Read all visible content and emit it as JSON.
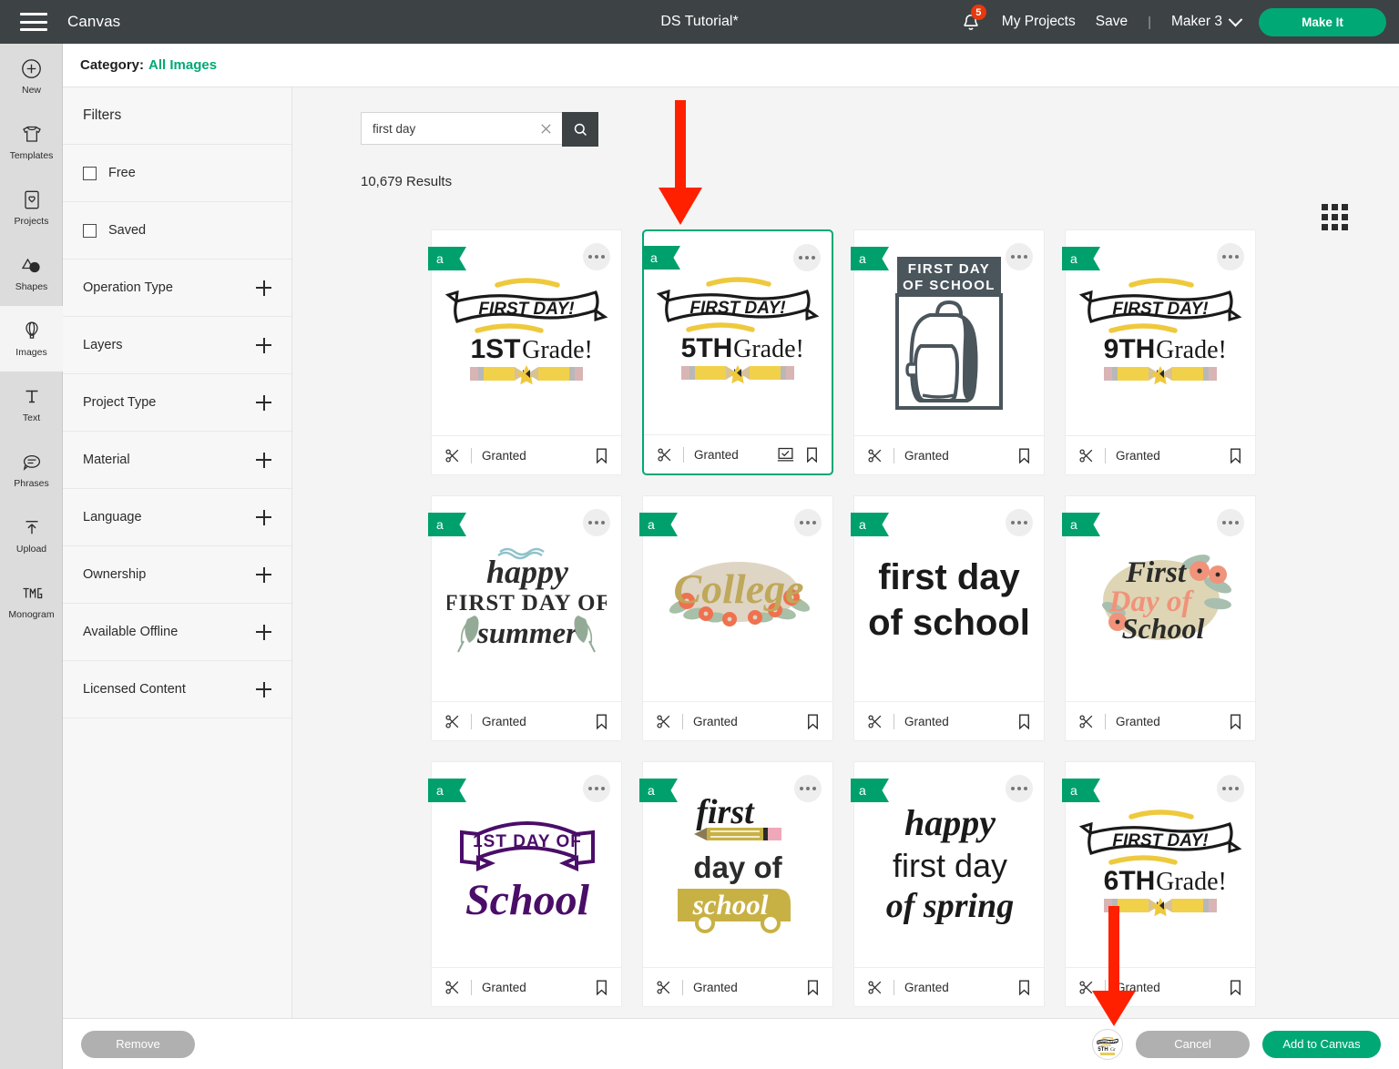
{
  "topbar": {
    "menu_icon": "hamburger-icon",
    "canvas_label": "Canvas",
    "document_title": "DS Tutorial*",
    "bell_icon": "notification-bell-icon",
    "notification_count": "5",
    "my_projects": "My Projects",
    "save": "Save",
    "divider": "|",
    "machine": "Maker 3",
    "machine_chevron": "chevron-down-icon",
    "make_it": "Make It",
    "accent_green": "#00a875",
    "bar_bg": "#3d4245",
    "badge_red": "#e8380d"
  },
  "rail": {
    "items": [
      {
        "label": "New",
        "icon": "plus-circle-icon",
        "active": false
      },
      {
        "label": "Templates",
        "icon": "tshirt-icon",
        "active": false
      },
      {
        "label": "Projects",
        "icon": "card-heart-icon",
        "active": false
      },
      {
        "label": "Shapes",
        "icon": "shapes-icon",
        "active": false
      },
      {
        "label": "Images",
        "icon": "hot-air-balloon-icon",
        "active": true
      },
      {
        "label": "Text",
        "icon": "text-t-icon",
        "active": false
      },
      {
        "label": "Phrases",
        "icon": "speech-bubble-icon",
        "active": false
      },
      {
        "label": "Upload",
        "icon": "upload-arrow-icon",
        "active": false
      },
      {
        "label": "Monogram",
        "icon": "monogram-icon",
        "active": false
      }
    ]
  },
  "category_bar": {
    "label": "Category:",
    "value": "All Images"
  },
  "filters": {
    "heading": "Filters",
    "checkboxes": [
      {
        "label": "Free",
        "checked": false
      },
      {
        "label": "Saved",
        "checked": false
      }
    ],
    "groups": [
      {
        "label": "Operation Type",
        "expander": "plus-icon"
      },
      {
        "label": "Layers",
        "expander": "plus-icon"
      },
      {
        "label": "Project Type",
        "expander": "plus-icon"
      },
      {
        "label": "Material",
        "expander": "plus-icon"
      },
      {
        "label": "Language",
        "expander": "plus-icon"
      },
      {
        "label": "Ownership",
        "expander": "plus-icon"
      },
      {
        "label": "Available Offline",
        "expander": "plus-icon"
      },
      {
        "label": "Licensed Content",
        "expander": "plus-icon"
      }
    ]
  },
  "search": {
    "value": "first day",
    "placeholder": "Search",
    "clear_icon": "close-x-icon",
    "search_icon": "magnifier-icon"
  },
  "results": {
    "count_text": "10,679 Results",
    "grid_toggle_icon": "grid-view-icon",
    "badge_letter": "a",
    "license_label": "Granted",
    "cut_icon": "scissors-icon",
    "bookmark_icon": "bookmark-icon",
    "canvas_check_icon": "added-to-canvas-icon",
    "more_icon": "more-dots-icon",
    "cards": [
      {
        "id": "first-day-1st-grade",
        "art": "grade-banner",
        "grade": "1ST",
        "selected": false,
        "license": "Granted"
      },
      {
        "id": "first-day-5th-grade",
        "art": "grade-banner",
        "grade": "5TH",
        "selected": true,
        "license": "Granted"
      },
      {
        "id": "first-day-of-school-backpack",
        "art": "backpack",
        "line1": "FIRST DAY",
        "line2": "OF SCHOOL",
        "selected": false,
        "license": "Granted"
      },
      {
        "id": "first-day-9th-grade",
        "art": "grade-banner",
        "grade": "9TH",
        "selected": false,
        "license": "Granted"
      },
      {
        "id": "happy-first-day-of-summer",
        "art": "summer",
        "line1": "happy",
        "line2": "FIRST DAY OF",
        "line3": "summer",
        "selected": false,
        "license": "Granted"
      },
      {
        "id": "college-floral",
        "art": "college",
        "line1": "College",
        "selected": false,
        "license": "Granted"
      },
      {
        "id": "first-day-of-school-plain",
        "art": "plain-text",
        "line1": "first day",
        "line2": "of school",
        "selected": false,
        "license": "Granted"
      },
      {
        "id": "first-day-of-school-floral",
        "art": "floral-script",
        "line1": "First",
        "line2": "Day of",
        "line3": "School",
        "selected": false,
        "license": "Granted"
      },
      {
        "id": "1st-day-of-school-purple",
        "art": "purple-banner",
        "line1": "1ST DAY OF",
        "line2": "School",
        "selected": false,
        "license": "Granted"
      },
      {
        "id": "first-day-of-school-bus",
        "art": "school-bus",
        "line1": "first",
        "line2": "day of",
        "line3": "school",
        "selected": false,
        "license": "Granted"
      },
      {
        "id": "happy-first-day-of-spring",
        "art": "spring-script",
        "line1": "happy",
        "line2": "first day",
        "line3": "of spring",
        "selected": false,
        "license": "Granted"
      },
      {
        "id": "first-day-6th-grade",
        "art": "grade-banner",
        "grade": "6TH",
        "selected": false,
        "license": "Granted"
      }
    ],
    "banner_text": "FIRST DAY!",
    "grade_suffix": "Grade!"
  },
  "bottombar": {
    "remove": "Remove",
    "cancel": "Cancel",
    "add_to_canvas": "Add to Canvas",
    "selected_thumb_icon": "selected-image-thumbnail"
  },
  "annotations": [
    {
      "name": "arrow-to-selected-card",
      "color": "#ff2000"
    },
    {
      "name": "arrow-to-selection-thumbnail",
      "color": "#ff2000"
    }
  ]
}
